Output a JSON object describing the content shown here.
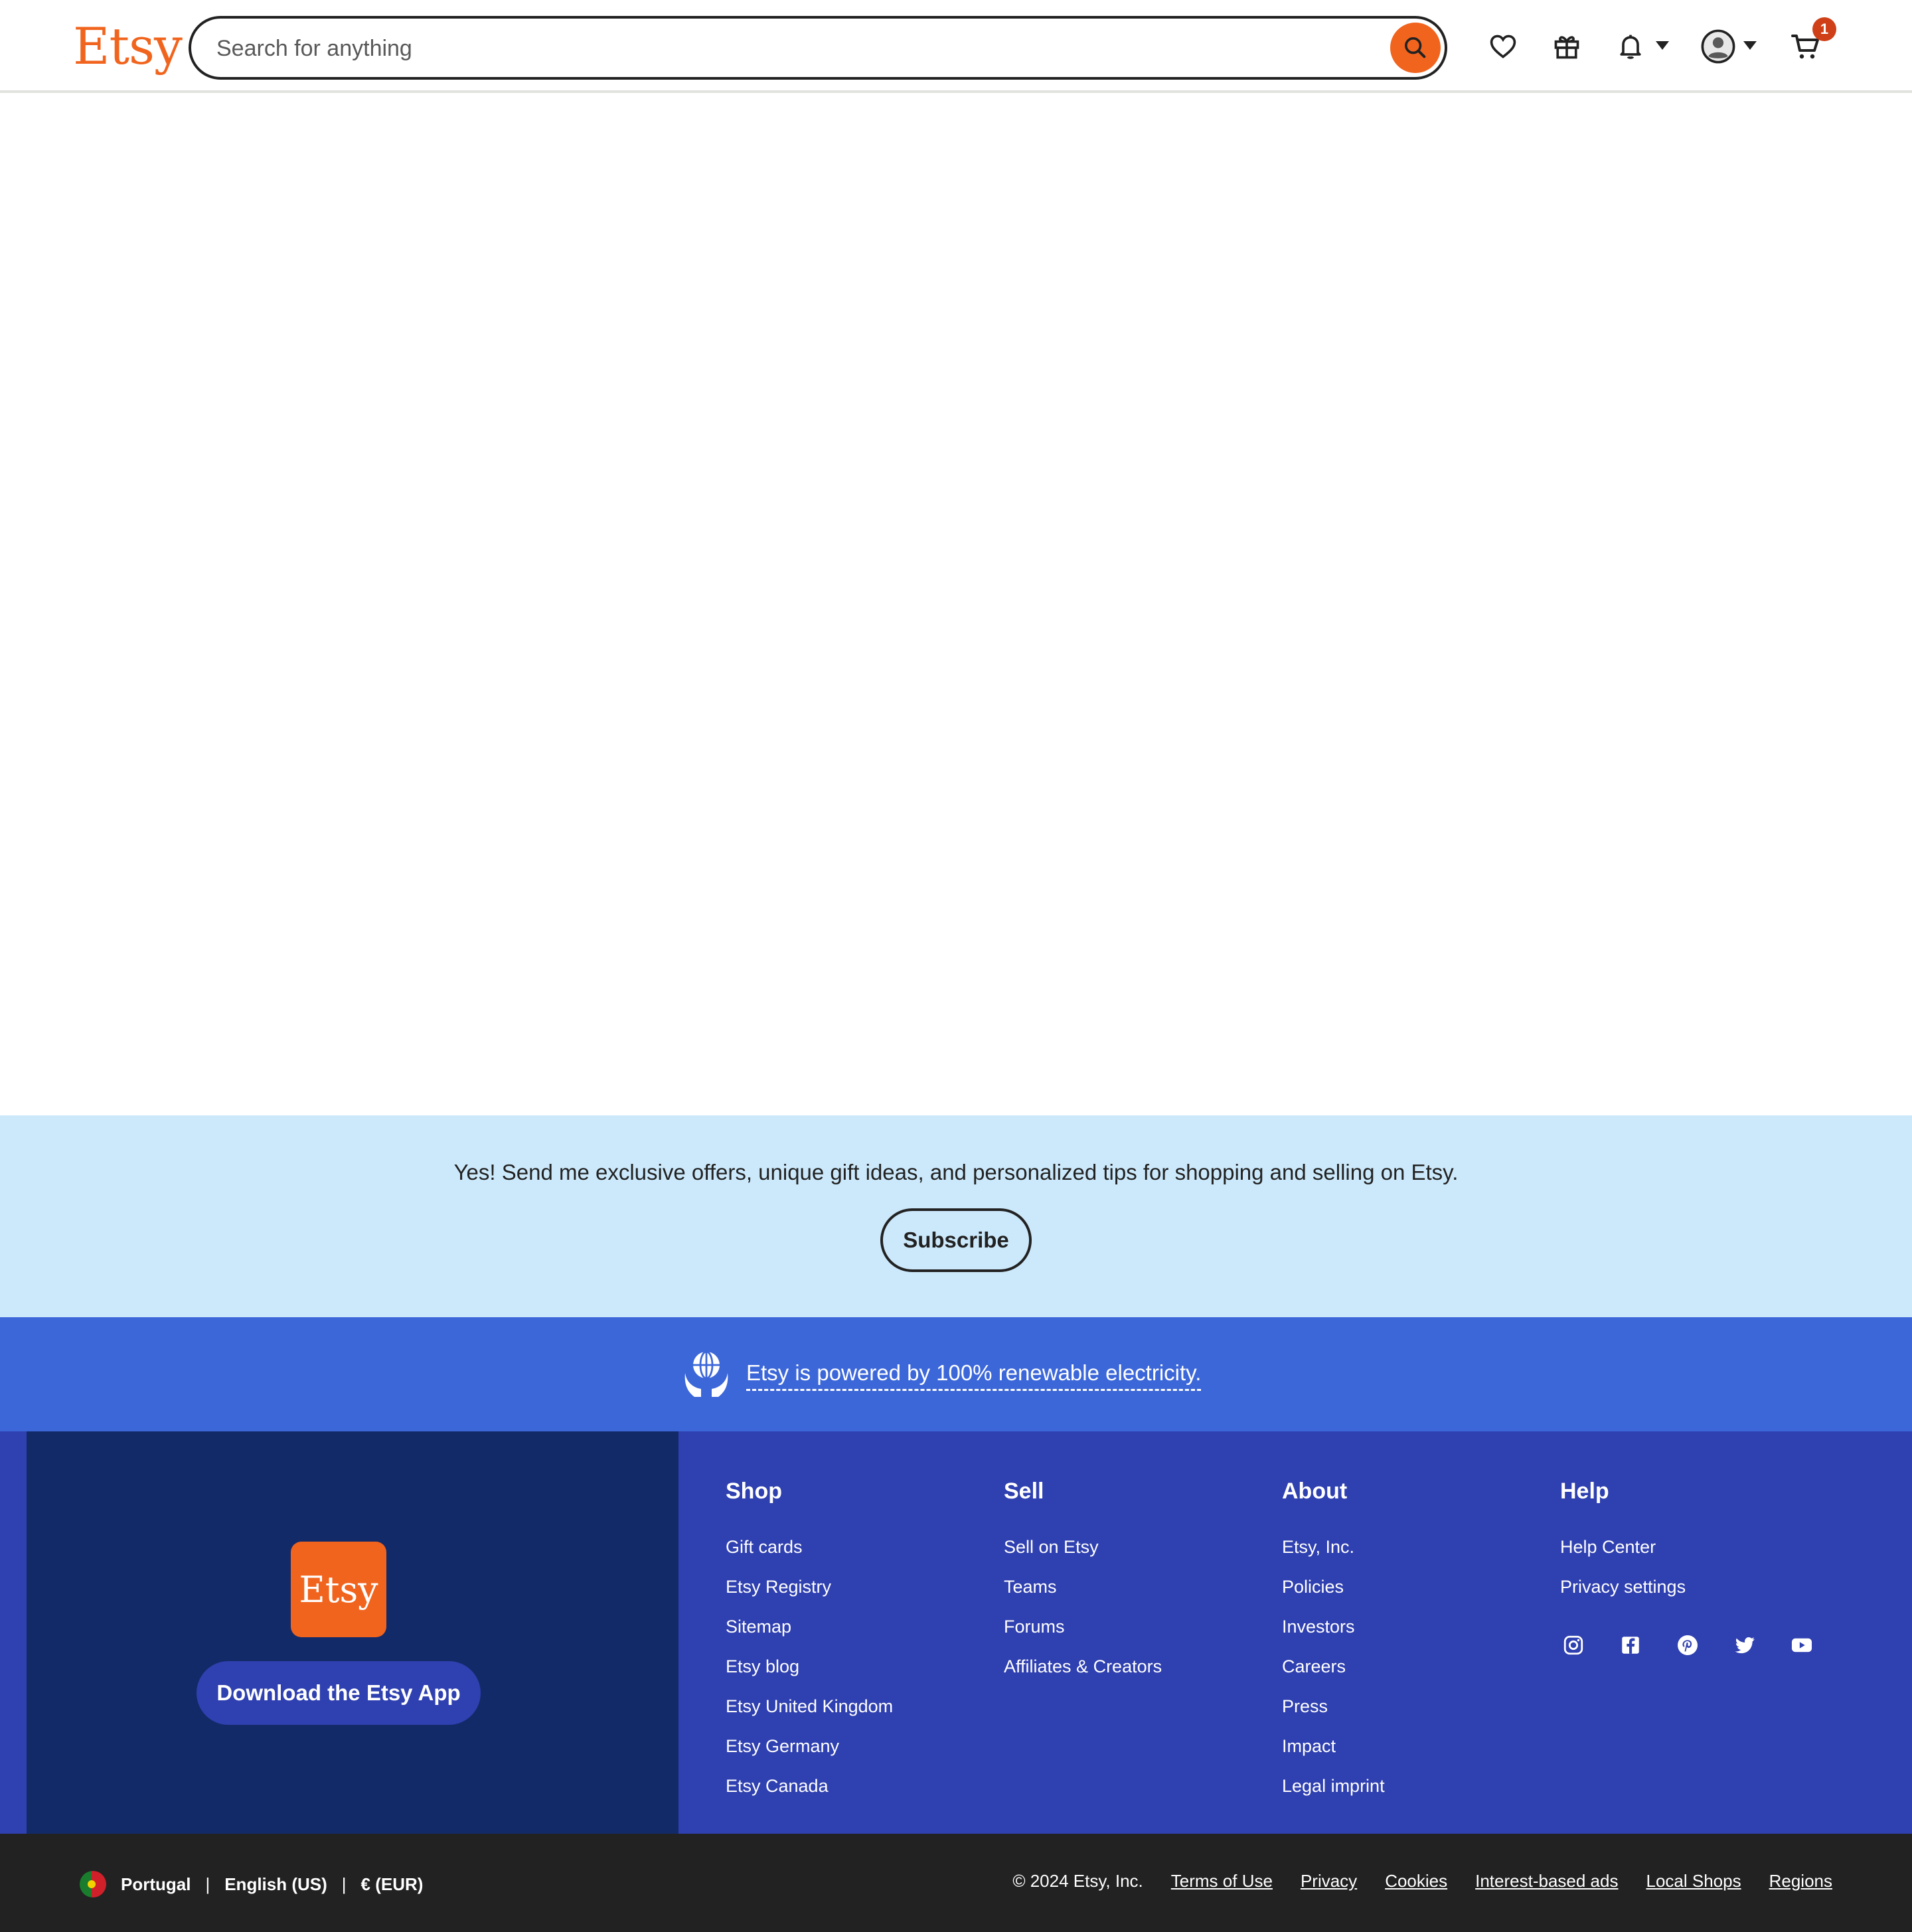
{
  "header": {
    "logo": "Etsy",
    "search_placeholder": "Search for anything",
    "cart_count": "1"
  },
  "subscribe": {
    "text": "Yes! Send me exclusive offers, unique gift ideas, and personalized tips for shopping and selling on Etsy.",
    "button": "Subscribe"
  },
  "renewable": {
    "link": "Etsy is powered by 100% renewable electricity."
  },
  "app": {
    "logo": "Etsy",
    "button": "Download the Etsy App"
  },
  "footer": {
    "shop": {
      "title": "Shop",
      "items": [
        "Gift cards",
        "Etsy Registry",
        "Sitemap",
        "Etsy blog",
        "Etsy United Kingdom",
        "Etsy Germany",
        "Etsy Canada"
      ]
    },
    "sell": {
      "title": "Sell",
      "items": [
        "Sell on Etsy",
        "Teams",
        "Forums",
        "Affiliates & Creators"
      ]
    },
    "about": {
      "title": "About",
      "items": [
        "Etsy, Inc.",
        "Policies",
        "Investors",
        "Careers",
        "Press",
        "Impact",
        "Legal imprint"
      ]
    },
    "help": {
      "title": "Help",
      "items": [
        "Help Center",
        "Privacy settings"
      ]
    },
    "social_icons": [
      "instagram-icon",
      "facebook-icon",
      "pinterest-icon",
      "twitter-icon",
      "youtube-icon"
    ]
  },
  "bottom": {
    "country": "Portugal",
    "language": "English (US)",
    "currency": "€ (EUR)",
    "separator": "|",
    "copyright": "© 2024 Etsy, Inc.",
    "links": [
      "Terms of Use",
      "Privacy",
      "Cookies",
      "Interest-based ads",
      "Local Shops",
      "Regions"
    ]
  },
  "colors": {
    "brand_orange": "#f1641e",
    "subscribe_bg": "#cce9fb",
    "renewable_bg": "#3c67d9",
    "footer_bg": "#2f40b0",
    "app_panel_bg": "#132a68",
    "bottom_bg": "#222222"
  }
}
